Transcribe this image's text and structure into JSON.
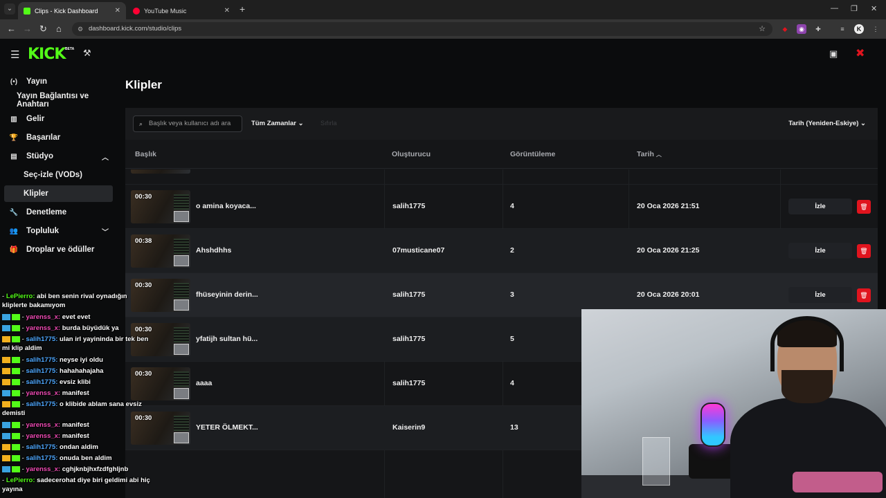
{
  "browser": {
    "tabs": [
      {
        "title": "Clips - Kick Dashboard",
        "active": true,
        "favicon_color": "#53fc18"
      },
      {
        "title": "YouTube Music",
        "active": false,
        "favicon_color": "#ff0033"
      }
    ],
    "url": "dashboard.kick.com/studio/clips"
  },
  "app": {
    "logo": "KICK",
    "beta": "BETA"
  },
  "sidebar": {
    "items": [
      {
        "label": "Yayın",
        "icon": "broadcast-icon"
      },
      {
        "label": "Yayın Bağlantısı ve Anahtarı",
        "icon": ""
      },
      {
        "label": "Gelir",
        "icon": "revenue-icon"
      },
      {
        "label": "Başarılar",
        "icon": "trophy-icon"
      },
      {
        "label": "Stüdyo",
        "icon": "studio-icon"
      },
      {
        "label": "Seç-izle (VODs)",
        "icon": ""
      },
      {
        "label": "Klipler",
        "icon": ""
      },
      {
        "label": "Denetleme",
        "icon": "wrench-icon"
      },
      {
        "label": "Topluluk",
        "icon": "community-icon"
      },
      {
        "label": "Droplar ve ödüller",
        "icon": "drops-icon"
      }
    ]
  },
  "page": {
    "title": "Klipler"
  },
  "filters": {
    "search_placeholder": "Başlık veya kullanıcı adı ara",
    "time_filter": "Tüm Zamanlar",
    "ghost_button": "Sıfırla",
    "sort": "Tarih (Yeniden-Eskiye)"
  },
  "table": {
    "columns": [
      "Başlık",
      "Oluşturucu",
      "Görüntüleme",
      "Tarih"
    ],
    "watch_label": "İzle",
    "rows": [
      {
        "duration": "00:30",
        "title": "o amina koyaca...",
        "creator": "salih1775",
        "views": "4",
        "date": "20 Oca 2026 21:51",
        "actions": true
      },
      {
        "duration": "00:38",
        "title": "Ahshdhhs",
        "creator": "07musticane07",
        "views": "2",
        "date": "20 Oca 2026 21:25",
        "actions": true
      },
      {
        "duration": "00:30",
        "title": "fhüseyinin derin...",
        "creator": "salih1775",
        "views": "3",
        "date": "20 Oca 2026 20:01",
        "actions": true
      },
      {
        "duration": "00:30",
        "title": "yfatijh sultan hü...",
        "creator": "salih1775",
        "views": "5",
        "date": "",
        "actions": false
      },
      {
        "duration": "00:30",
        "title": "aaaa",
        "creator": "salih1775",
        "views": "4",
        "date": "",
        "actions": false
      },
      {
        "duration": "00:30",
        "title": "YETER ÖLMEKT...",
        "creator": "Kaiserin9",
        "views": "13",
        "date": "",
        "actions": false
      }
    ]
  },
  "chat": {
    "messages": [
      {
        "user": "LePierro:",
        "text": "abi ben senin rival oynadığın kliplerte bakamıyom",
        "color": "green",
        "badge": "none"
      },
      {
        "user": "yarenss_x:",
        "text": "evet evet",
        "color": "pink",
        "badge": "blue"
      },
      {
        "user": "yarenss_x:",
        "text": "burda büyüdük ya",
        "color": "pink",
        "badge": "blue"
      },
      {
        "user": "salih1775:",
        "text": "ulan irl yayininda bir tek ben mi klip aldim",
        "color": "blue",
        "badge": "gold"
      },
      {
        "user": "salih1775:",
        "text": "neyse iyi oldu",
        "color": "blue",
        "badge": "gold"
      },
      {
        "user": "salih1775:",
        "text": "hahahahajaha",
        "color": "blue",
        "badge": "gold"
      },
      {
        "user": "salih1775:",
        "text": "evsiz klibi",
        "color": "blue",
        "badge": "gold"
      },
      {
        "user": "yarenss_x:",
        "text": "manifest",
        "color": "pink",
        "badge": "blue"
      },
      {
        "user": "salih1775:",
        "text": "o klibide ablam sana evsiz demisti",
        "color": "blue",
        "badge": "gold"
      },
      {
        "user": "yarenss_x:",
        "text": "manifest",
        "color": "pink",
        "badge": "blue"
      },
      {
        "user": "yarenss_x:",
        "text": "manifest",
        "color": "pink",
        "badge": "blue"
      },
      {
        "user": "salih1775:",
        "text": "ondan aldim",
        "color": "blue",
        "badge": "gold"
      },
      {
        "user": "salih1775:",
        "text": "onuda ben aldim",
        "color": "blue",
        "badge": "gold"
      },
      {
        "user": "yarenss_x:",
        "text": "cghjknbjhxfzdfghljnb",
        "color": "pink",
        "badge": "blue"
      },
      {
        "user": "LePierro:",
        "text": "sadecerohat diye biri geldimi abi hiç yayına",
        "color": "green",
        "badge": "none"
      }
    ]
  },
  "colors": {
    "brand": "#53fc18",
    "danger": "#e0141e",
    "background": "#0b0c0d"
  }
}
